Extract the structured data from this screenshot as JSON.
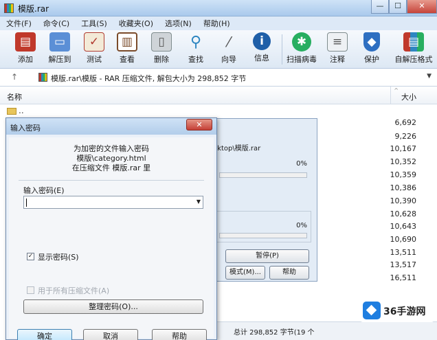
{
  "window": {
    "title": "模版.rar",
    "minimize": "—",
    "maximize": "☐",
    "close": "✕"
  },
  "menu": [
    "文件(F)",
    "命令(C)",
    "工具(S)",
    "收藏夹(O)",
    "选项(N)",
    "帮助(H)"
  ],
  "toolbar": [
    {
      "label": "添加",
      "icon": "add-archive-icon",
      "color": "#c0392b"
    },
    {
      "label": "解压到",
      "icon": "extract-folder-icon",
      "color": "#5b8fd6"
    },
    {
      "label": "测试",
      "icon": "test-icon",
      "color": "#b03a2e"
    },
    {
      "label": "查看",
      "icon": "view-book-icon",
      "color": "#7a4b2a"
    },
    {
      "label": "删除",
      "icon": "delete-bin-icon",
      "color": "#7f8c8d"
    },
    {
      "label": "查找",
      "icon": "find-magnifier-icon",
      "color": "#2e86c1"
    },
    {
      "label": "向导",
      "icon": "wizard-wand-icon",
      "color": "#555555"
    },
    {
      "label": "信息",
      "icon": "info-icon",
      "color": "#1f5fa8"
    },
    {
      "label": "扫描病毒",
      "icon": "scan-virus-icon",
      "color": "#27ae60"
    },
    {
      "label": "注释",
      "icon": "comment-icon",
      "color": "#7f8c8d"
    },
    {
      "label": "保护",
      "icon": "protect-shield-icon",
      "color": "#2e6fc1"
    },
    {
      "label": "自解压格式",
      "icon": "sfx-icon",
      "color": "#c0392b"
    }
  ],
  "pathbar": {
    "text": "模版.rar\\模版 - RAR 压缩文件, 解包大小为 298,852 字节"
  },
  "list": {
    "col_name": "名称",
    "col_size": "大小",
    "up_label": "..",
    "sizes": [
      "6,692",
      "9,226",
      "10,167",
      "10,352",
      "10,359",
      "10,386",
      "10,390",
      "10,628",
      "10,643",
      "10,690",
      "13,511",
      "13,517",
      "16,511"
    ]
  },
  "extract_dialog": {
    "path": "sktop\\模版.rar",
    "pct1": "0%",
    "pct2": "0%",
    "pause_button": "暂停(P)",
    "mode_button": "模式(M)...",
    "help_button": "帮助"
  },
  "password_dialog": {
    "title": "输入密码",
    "close": "✕",
    "message_line1": "为加密的文件输入密码",
    "message_line2": "模版\\category.html",
    "message_line3": "在压缩文件 模版.rar 里",
    "password_label": "输入密码(E)",
    "password_value": "",
    "show_password_label": "显示密码(S)",
    "show_password_checked": "✓",
    "use_for_all_label": "用于所有压缩文件(A)",
    "organize_button": "整理密码(O)...",
    "ok_button": "确定",
    "cancel_button": "取消",
    "help_button": "帮助"
  },
  "status": {
    "text": "总计 298,852 字节(19 个"
  },
  "watermark": {
    "text": "36手游网"
  }
}
